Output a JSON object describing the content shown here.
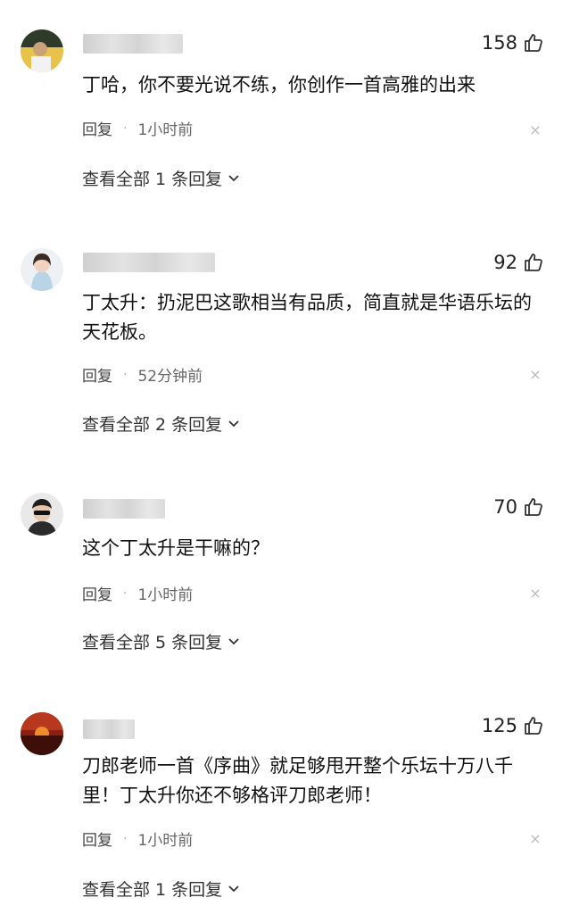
{
  "comments": [
    {
      "likes": "158",
      "text": "丁哈，你不要光说不练，你创作一首高雅的出来",
      "reply_label": "回复",
      "time": "1小时前",
      "view_replies": "查看全部 1 条回复"
    },
    {
      "likes": "92",
      "text": "丁太升：扔泥巴这歌相当有品质，简直就是华语乐坛的天花板。",
      "reply_label": "回复",
      "time": "52分钟前",
      "view_replies": "查看全部 2 条回复"
    },
    {
      "likes": "70",
      "text": "这个丁太升是干嘛的？",
      "reply_label": "回复",
      "time": "1小时前",
      "view_replies": "查看全部 5 条回复"
    },
    {
      "likes": "125",
      "text": "刀郎老师一首《序曲》就足够甩开整个乐坛十万八千里！丁太升你还不够格评刀郎老师！",
      "reply_label": "回复",
      "time": "1小时前",
      "view_replies": "查看全部 1 条回复"
    }
  ],
  "icons": {
    "like": "thumbs-up-icon",
    "close": "close-icon",
    "expand": "chevron-down-icon"
  }
}
